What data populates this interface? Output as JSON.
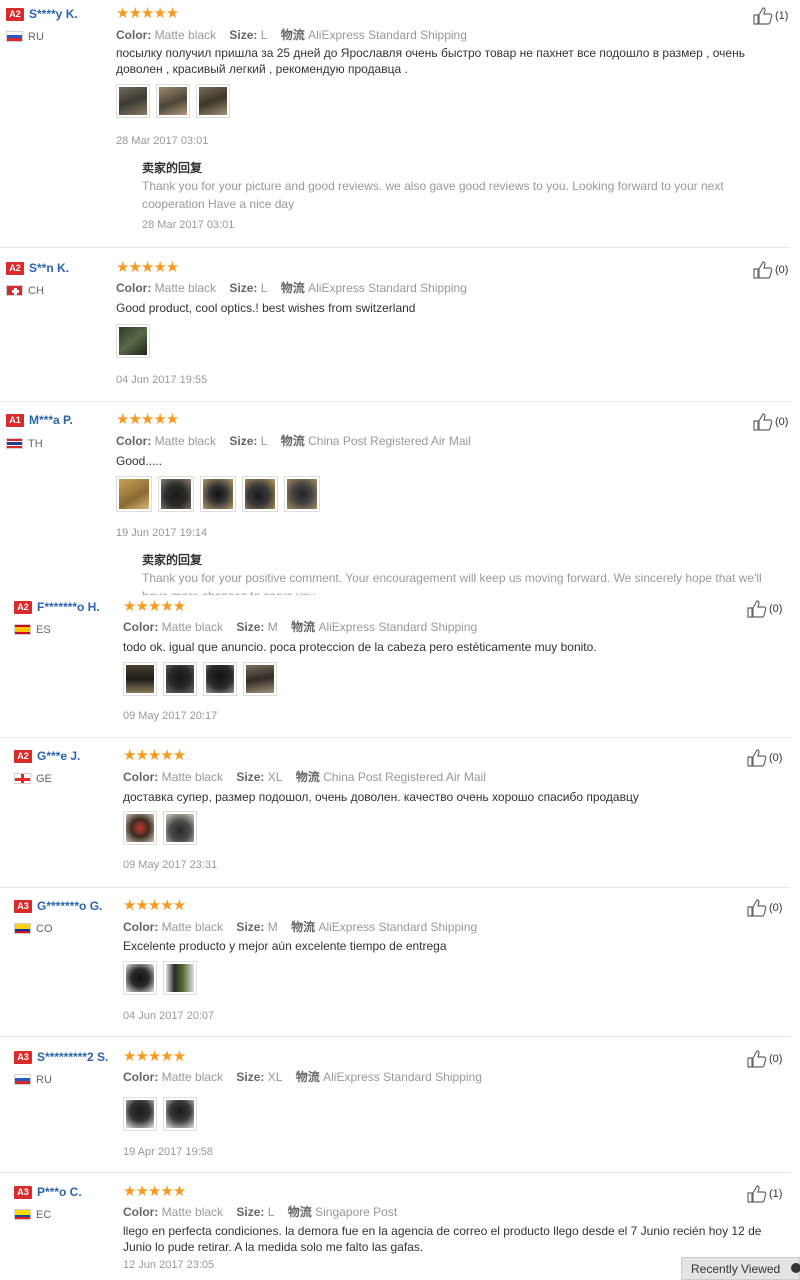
{
  "labels": {
    "color": "Color:",
    "size": "Size:",
    "shipping": "物流"
  },
  "reviews": [
    {
      "badge": "A2",
      "name": "S****y K.",
      "country": "RU",
      "stars": "★★★★★",
      "color": "Matte black",
      "size": "L",
      "shipping": "AliExpress Standard Shipping",
      "text": "посылку получил пришла за 25 дней до Ярославля очень быстро товар не пахнет все подошло в размер , очень доволен , красивый легкий , рекомендую продавца .",
      "date": "28 Mar 2017 03:01",
      "likes": "(1)",
      "reply_title": "卖家的回复",
      "reply_text": "Thank you for your picture and good reviews. we also gave good reviews to you. Looking forward to your next cooperation Have a nice day",
      "reply_date": "28 Mar 2017 03:01"
    },
    {
      "badge": "A2",
      "name": "S**n K.",
      "country": "CH",
      "stars": "★★★★★",
      "color": "Matte black",
      "size": "L",
      "shipping": "AliExpress Standard Shipping",
      "text": "Good product, cool optics.! best wishes from switzerland",
      "date": "04 Jun 2017 19:55",
      "likes": "(0)"
    },
    {
      "badge": "A1",
      "name": "M***a P.",
      "country": "TH",
      "stars": "★★★★★",
      "color": "Matte black",
      "size": "L",
      "shipping": "China Post Registered Air Mail",
      "text": "Good.....",
      "date": "19 Jun 2017 19:14",
      "likes": "(0)",
      "reply_title": "卖家的回复",
      "reply_text": "Thank you for your positive comment. Your encouragement will keep us moving forward. We sincerely hope that we'll have more chances to serve you."
    },
    {
      "badge": "A2",
      "name": "F*******o H.",
      "country": "ES",
      "stars": "★★★★★",
      "color": "Matte black",
      "size": "M",
      "shipping": "AliExpress Standard Shipping",
      "text": "todo ok. igual que anuncio. poca proteccion de la cabeza pero estéticamente muy bonito.",
      "date": "09 May 2017 20:17",
      "likes": "(0)"
    },
    {
      "badge": "A2",
      "name": "G***e J.",
      "country": "GE",
      "stars": "★★★★★",
      "color": "Matte black",
      "size": "XL",
      "shipping": "China Post Registered Air Mail",
      "text": "доставка супер, размер подошол, очень доволен. качество очень хорошо спасибо продавцу",
      "date": "09 May 2017 23:31",
      "likes": "(0)"
    },
    {
      "badge": "A3",
      "name": "G*******o G.",
      "country": "CO",
      "stars": "★★★★★",
      "color": "Matte black",
      "size": "M",
      "shipping": "AliExpress Standard Shipping",
      "text": "Excelente producto y mejor aún excelente tiempo de entrega",
      "date": "04 Jun 2017 20:07",
      "likes": "(0)"
    },
    {
      "badge": "A3",
      "name": "S*********2 S.",
      "country": "RU",
      "stars": "★★★★★",
      "color": "Matte black",
      "size": "XL",
      "shipping": "AliExpress Standard Shipping",
      "text": "",
      "date": "19 Apr 2017 19:58",
      "likes": "(0)"
    },
    {
      "badge": "A3",
      "name": "P***o C.",
      "country": "EC",
      "stars": "★★★★★",
      "color": "Matte black",
      "size": "L",
      "shipping": "Singapore Post",
      "text": "llego en perfecta condiciones. la demora fue en la agencia de correo el producto llego desde el 7 Junio recién hoy 12 de Junio lo pude retirar. A la medida solo me falto las gafas.",
      "date": "12 Jun 2017 23:05",
      "likes": "(1)"
    }
  ],
  "recently_viewed": "Recently Viewed",
  "colors": {
    "link": "#2a64ad",
    "star": "#f79a1e",
    "badge": "#d92b2b",
    "muted": "#999999"
  }
}
